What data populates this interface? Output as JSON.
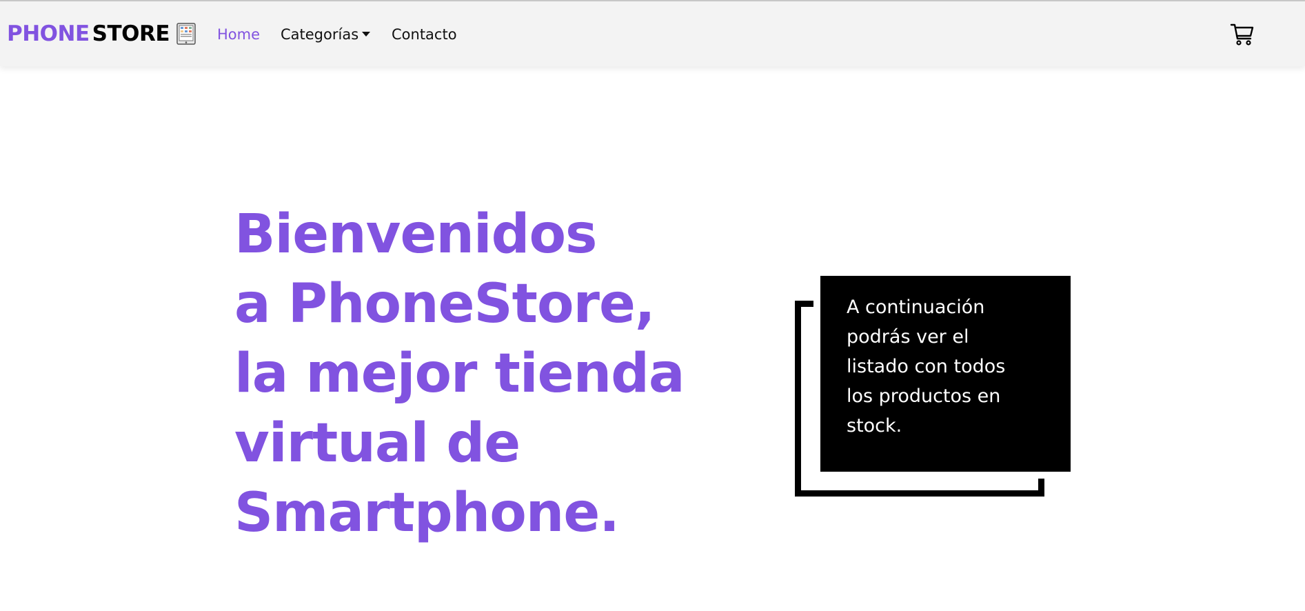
{
  "brand": {
    "part1": "PHONE",
    "part2": "STORE",
    "icon": "tablet-icon",
    "accent_color": "#8153e0"
  },
  "nav": {
    "home": "Home",
    "categories": "Categorías",
    "contact": "Contacto"
  },
  "cart": {
    "icon": "cart-icon"
  },
  "hero": {
    "lines": [
      "Bienvenidos",
      "a PhoneStore,",
      "la mejor tienda",
      "virtual de",
      "Smartphone."
    ]
  },
  "info": {
    "lines": [
      "A continuación",
      "podrás ver el",
      "listado con todos",
      "los productos en",
      "stock."
    ]
  }
}
